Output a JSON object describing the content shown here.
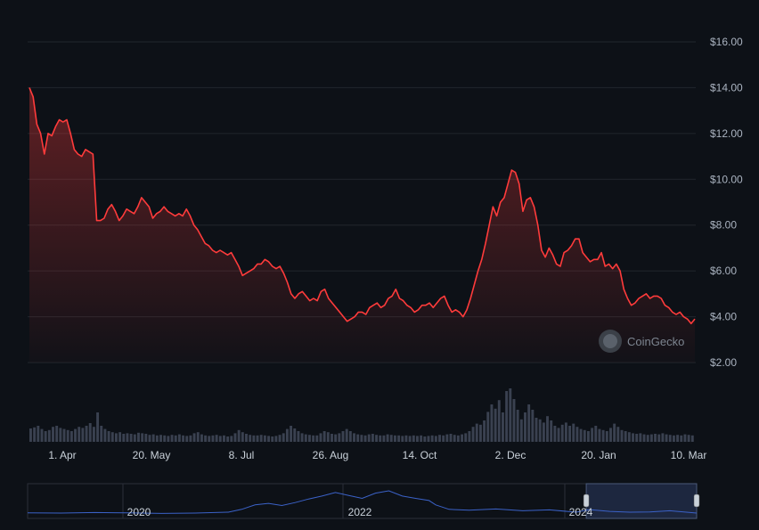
{
  "watermark": "CoinGecko",
  "colors": {
    "background": "#0d1117",
    "line": "#ff3b3b",
    "grid": "#21262d",
    "volume": "#3a4150",
    "navigator_line": "#3b62c8",
    "navigator_fill": "#1f2a44"
  },
  "navigator": {
    "labels": [
      "2020",
      "2022",
      "2024"
    ],
    "window_start": 0.835,
    "window_end": 1.0
  },
  "chart_data": {
    "type": "line",
    "title": "",
    "xlabel": "",
    "ylabel": "",
    "yticks": [
      "$2.00",
      "$4.00",
      "$6.00",
      "$8.00",
      "$10.00",
      "$12.00",
      "$14.00",
      "$16.00"
    ],
    "xticks": [
      "1. Apr",
      "20. May",
      "8. Jul",
      "26. Aug",
      "14. Oct",
      "2. Dec",
      "20. Jan",
      "10. Mar"
    ],
    "ylim": [
      2,
      16
    ],
    "grid": true,
    "series": [
      {
        "values": [
          14.0,
          13.6,
          12.4,
          12.0,
          11.1,
          12.0,
          11.9,
          12.3,
          12.6,
          12.5,
          12.6,
          12.0,
          11.3,
          11.1,
          11.0,
          11.3,
          11.2,
          11.1,
          8.2,
          8.2,
          8.3,
          8.7,
          8.9,
          8.6,
          8.2,
          8.4,
          8.7,
          8.6,
          8.5,
          8.8,
          9.2,
          9.0,
          8.8,
          8.3,
          8.5,
          8.6,
          8.8,
          8.6,
          8.5,
          8.4,
          8.5,
          8.4,
          8.7,
          8.4,
          8.0,
          7.8,
          7.5,
          7.2,
          7.1,
          6.9,
          6.8,
          6.9,
          6.8,
          6.7,
          6.8,
          6.5,
          6.2,
          5.8,
          5.9,
          6.0,
          6.1,
          6.3,
          6.3,
          6.5,
          6.4,
          6.2,
          6.1,
          6.2,
          5.9,
          5.5,
          5.0,
          4.8,
          5.0,
          5.1,
          4.9,
          4.7,
          4.8,
          4.7,
          5.1,
          5.2,
          4.8,
          4.6,
          4.4,
          4.2,
          4.0,
          3.8,
          3.9,
          4.0,
          4.2,
          4.2,
          4.1,
          4.4,
          4.5,
          4.6,
          4.4,
          4.5,
          4.8,
          4.9,
          5.2,
          4.8,
          4.7,
          4.5,
          4.4,
          4.2,
          4.3,
          4.5,
          4.5,
          4.6,
          4.4,
          4.6,
          4.8,
          4.9,
          4.5,
          4.2,
          4.3,
          4.2,
          4.0,
          4.3,
          4.8,
          5.4,
          6.0,
          6.5,
          7.2,
          8.0,
          8.8,
          8.4,
          9.0,
          9.2,
          9.8,
          10.4,
          10.3,
          9.8,
          8.6,
          9.1,
          9.2,
          8.8,
          8.0,
          6.9,
          6.6,
          7.0,
          6.7,
          6.3,
          6.2,
          6.8,
          6.9,
          7.1,
          7.4,
          7.4,
          6.8,
          6.6,
          6.4,
          6.5,
          6.5,
          6.8,
          6.2,
          6.3,
          6.1,
          6.3,
          6.0,
          5.2,
          4.8,
          4.5,
          4.6,
          4.8,
          4.9,
          5.0,
          4.8,
          4.9,
          4.9,
          4.8,
          4.5,
          4.4,
          4.2,
          4.1,
          4.2,
          4.0,
          3.9,
          3.7,
          3.9
        ]
      }
    ],
    "volume": [
      0.25,
      0.27,
      0.3,
      0.24,
      0.2,
      0.22,
      0.28,
      0.3,
      0.26,
      0.24,
      0.22,
      0.2,
      0.24,
      0.28,
      0.26,
      0.3,
      0.35,
      0.28,
      0.55,
      0.3,
      0.24,
      0.2,
      0.18,
      0.16,
      0.18,
      0.15,
      0.16,
      0.15,
      0.14,
      0.17,
      0.16,
      0.15,
      0.13,
      0.14,
      0.12,
      0.13,
      0.12,
      0.11,
      0.13,
      0.12,
      0.14,
      0.12,
      0.11,
      0.12,
      0.16,
      0.18,
      0.14,
      0.12,
      0.11,
      0.12,
      0.13,
      0.11,
      0.12,
      0.1,
      0.11,
      0.16,
      0.22,
      0.18,
      0.15,
      0.13,
      0.12,
      0.12,
      0.13,
      0.12,
      0.11,
      0.1,
      0.11,
      0.13,
      0.16,
      0.24,
      0.3,
      0.25,
      0.2,
      0.16,
      0.14,
      0.13,
      0.12,
      0.12,
      0.16,
      0.2,
      0.18,
      0.15,
      0.14,
      0.16,
      0.2,
      0.24,
      0.2,
      0.16,
      0.14,
      0.13,
      0.12,
      0.14,
      0.15,
      0.13,
      0.12,
      0.12,
      0.14,
      0.13,
      0.12,
      0.12,
      0.11,
      0.12,
      0.11,
      0.12,
      0.11,
      0.12,
      0.1,
      0.11,
      0.12,
      0.11,
      0.13,
      0.12,
      0.14,
      0.15,
      0.13,
      0.12,
      0.14,
      0.16,
      0.2,
      0.28,
      0.34,
      0.32,
      0.4,
      0.56,
      0.7,
      0.62,
      0.78,
      0.55,
      0.95,
      1.0,
      0.8,
      0.6,
      0.42,
      0.55,
      0.7,
      0.6,
      0.45,
      0.42,
      0.36,
      0.48,
      0.4,
      0.3,
      0.26,
      0.32,
      0.36,
      0.3,
      0.34,
      0.28,
      0.24,
      0.22,
      0.2,
      0.26,
      0.3,
      0.24,
      0.22,
      0.2,
      0.26,
      0.34,
      0.28,
      0.22,
      0.2,
      0.18,
      0.16,
      0.15,
      0.16,
      0.14,
      0.13,
      0.14,
      0.15,
      0.14,
      0.16,
      0.14,
      0.13,
      0.12,
      0.13,
      0.12,
      0.14,
      0.13,
      0.12
    ]
  }
}
